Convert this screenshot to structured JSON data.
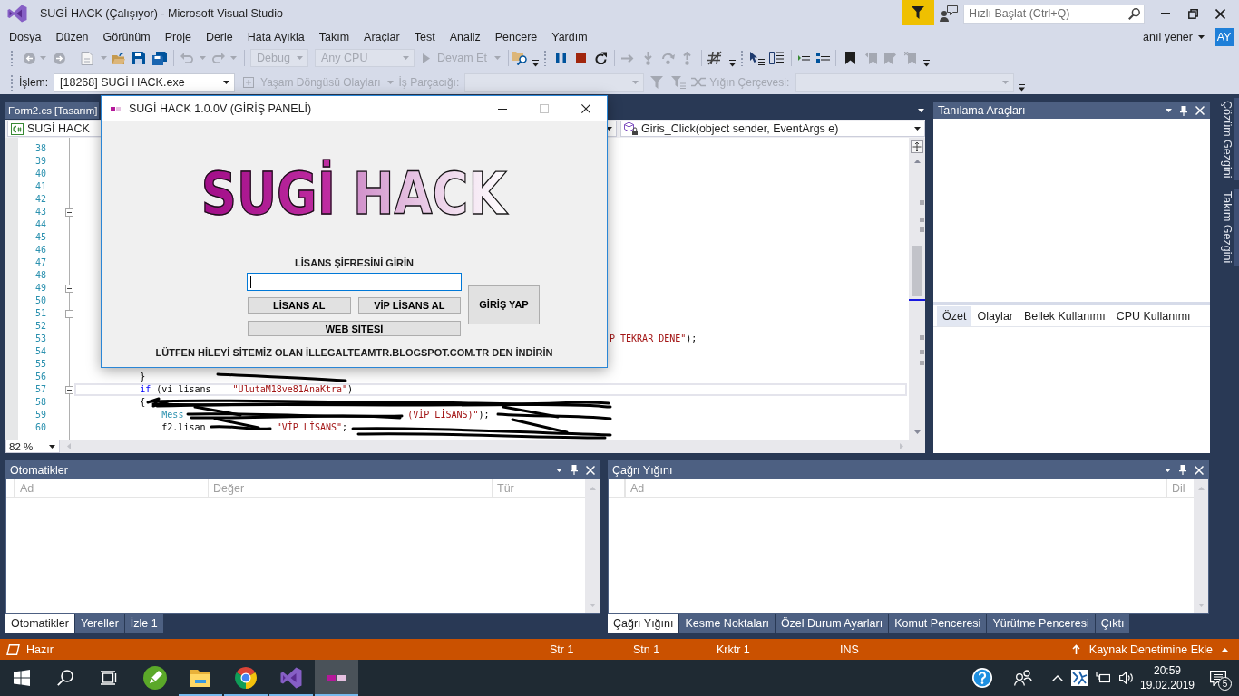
{
  "window": {
    "title": "SUGİ HACK (Çalışıyor) - Microsoft Visual Studio",
    "quick_launch": {
      "placeholder": "Hızlı Başlat (Ctrl+Q)"
    }
  },
  "menu": {
    "items": [
      "Dosya",
      "Düzen",
      "Görünüm",
      "Proje",
      "Derle",
      "Hata Ayıkla",
      "Takım",
      "Araçlar",
      "Test",
      "Analiz",
      "Pencere",
      "Yardım"
    ],
    "user": {
      "name": "anıl yener",
      "initials": "AY"
    }
  },
  "toolbar": {
    "configuration": {
      "value": "Debug",
      "disabled": true
    },
    "platform": {
      "value": "Any CPU",
      "disabled": true
    },
    "continue_button": {
      "label": "Devam Et",
      "disabled": true
    }
  },
  "debug_location": {
    "process": {
      "label": "İşlem:",
      "value": "[18268] SUGİ HACK.exe"
    },
    "lifecycle_events": {
      "label": "Yaşam Döngüsü Olayları",
      "disabled": true
    },
    "thread": {
      "label": "İş Parçacığı:",
      "disabled": true
    },
    "stack_frame": {
      "label": "Yığın Çerçevesi:",
      "disabled": true
    }
  },
  "editor": {
    "document_tab": "Form2.cs [Tasarım]",
    "project_dropdown": "SUGİ HACK",
    "member_dropdown": "Giris_Click(object sender, EventArgs e)",
    "zoom": "82 %",
    "lines": [
      {
        "number": "38",
        "collapsible": false,
        "current": false
      },
      {
        "number": "39",
        "collapsible": false,
        "current": false
      },
      {
        "number": "40",
        "collapsible": false,
        "current": false
      },
      {
        "number": "41",
        "collapsible": false,
        "current": false
      },
      {
        "number": "42",
        "collapsible": false,
        "current": false
      },
      {
        "number": "43",
        "collapsible": true,
        "current": false
      },
      {
        "number": "44",
        "collapsible": false,
        "current": false
      },
      {
        "number": "45",
        "collapsible": false,
        "current": false
      },
      {
        "number": "46",
        "collapsible": false,
        "current": false
      },
      {
        "number": "47",
        "collapsible": false,
        "current": false
      },
      {
        "number": "48",
        "collapsible": false,
        "current": false
      },
      {
        "number": "49",
        "collapsible": true,
        "current": false
      },
      {
        "number": "50",
        "collapsible": false,
        "current": false
      },
      {
        "number": "51",
        "collapsible": true,
        "current": false
      },
      {
        "number": "52",
        "collapsible": false,
        "current": false
      },
      {
        "number": "53",
        "collapsible": false,
        "current": false,
        "code": [
          {
            "kind": "string",
            "text": "                                                                                                  P TEKRAR DENE\""
          },
          {
            "kind": "plain",
            "text": ");"
          }
        ]
      },
      {
        "number": "54",
        "collapsible": false,
        "current": false
      },
      {
        "number": "55",
        "collapsible": false,
        "current": false
      },
      {
        "number": "56",
        "collapsible": false,
        "current": false,
        "code": [
          {
            "kind": "plain",
            "text": "            }"
          }
        ]
      },
      {
        "number": "57",
        "collapsible": true,
        "current": true,
        "code": [
          {
            "kind": "keyword",
            "text": "            if"
          },
          {
            "kind": "plain",
            "text": " (vi lisans"
          },
          {
            "kind": "string",
            "text": "    \"UlutaM18ve81AnaKtra\""
          },
          {
            "kind": "plain",
            "text": ")"
          }
        ]
      },
      {
        "number": "58",
        "collapsible": false,
        "current": false,
        "code": [
          {
            "kind": "plain",
            "text": "            {"
          }
        ]
      },
      {
        "number": "59",
        "collapsible": false,
        "current": false,
        "code": [
          {
            "kind": "type",
            "text": "                Mess"
          },
          {
            "kind": "string",
            "text": "                                         (VİP LİSANS)\""
          },
          {
            "kind": "plain",
            "text": ");"
          }
        ]
      },
      {
        "number": "60",
        "collapsible": false,
        "current": false,
        "code": [
          {
            "kind": "plain",
            "text": "                f2.lisan"
          },
          {
            "kind": "string",
            "text": "             \"VİP LİSANS\""
          },
          {
            "kind": "plain",
            "text": ";"
          }
        ]
      }
    ]
  },
  "diagnostics": {
    "title": "Tanılama Araçları",
    "tabs": [
      {
        "label": "Özet",
        "selected": true
      },
      {
        "label": "Olaylar",
        "selected": false
      },
      {
        "label": "Bellek Kullanımı",
        "selected": false
      },
      {
        "label": "CPU Kullanımı",
        "selected": false
      }
    ]
  },
  "side_tabs": [
    "Çözüm Gezgini",
    "Takım Gezgini"
  ],
  "autos": {
    "title": "Otomatikler",
    "columns": [
      "Ad",
      "Değer",
      "Tür"
    ],
    "tabs": [
      {
        "label": "Otomatikler",
        "selected": true
      },
      {
        "label": "Yereller",
        "selected": false
      },
      {
        "label": "İzle 1",
        "selected": false
      }
    ]
  },
  "call_stack": {
    "title": "Çağrı Yığını",
    "columns": [
      "Ad",
      "Dil"
    ],
    "tabs": [
      {
        "label": "Çağrı Yığını",
        "selected": true
      },
      {
        "label": "Kesme Noktaları",
        "selected": false
      },
      {
        "label": "Özel Durum Ayarları",
        "selected": false
      },
      {
        "label": "Komut Penceresi",
        "selected": false
      },
      {
        "label": "Yürütme Penceresi",
        "selected": false
      },
      {
        "label": "Çıktı",
        "selected": false
      }
    ]
  },
  "status_bar": {
    "state": "Hazır",
    "line": "Str 1",
    "column": "Stn 1",
    "character": "Krktr 1",
    "mode": "INS",
    "source_control": "Kaynak Denetimine Ekle"
  },
  "taskbar": {
    "apps": [
      {
        "running": false,
        "selected": false
      },
      {
        "running": true,
        "selected": false
      },
      {
        "running": true,
        "selected": false
      },
      {
        "running": true,
        "selected": false
      },
      {
        "running": true,
        "selected": true
      }
    ],
    "time": "20:59",
    "date": "19.02.2019",
    "notification_count": "5"
  },
  "dialog": {
    "title": "SUGİ HACK 1.0.0V (GİRİŞ PANELİ)",
    "maximize": {
      "disabled": true
    },
    "logo": "SUGİ HACK",
    "prompt": "LİSANS ŞİFRESİNİ GİRİN",
    "license_field": {
      "focused": true
    },
    "buttons": [
      {
        "label": "LİSANS AL"
      },
      {
        "label": "VİP LİSANS AL"
      }
    ],
    "web_button": "WEB SİTESİ",
    "login_button": "GİRİŞ YAP",
    "footer": "LÜTFEN HİLEYİ SİTEMİZ OLAN İLLEGALTEAMTR.BLOGSPOT.COM.TR DEN İNDİRİN"
  }
}
